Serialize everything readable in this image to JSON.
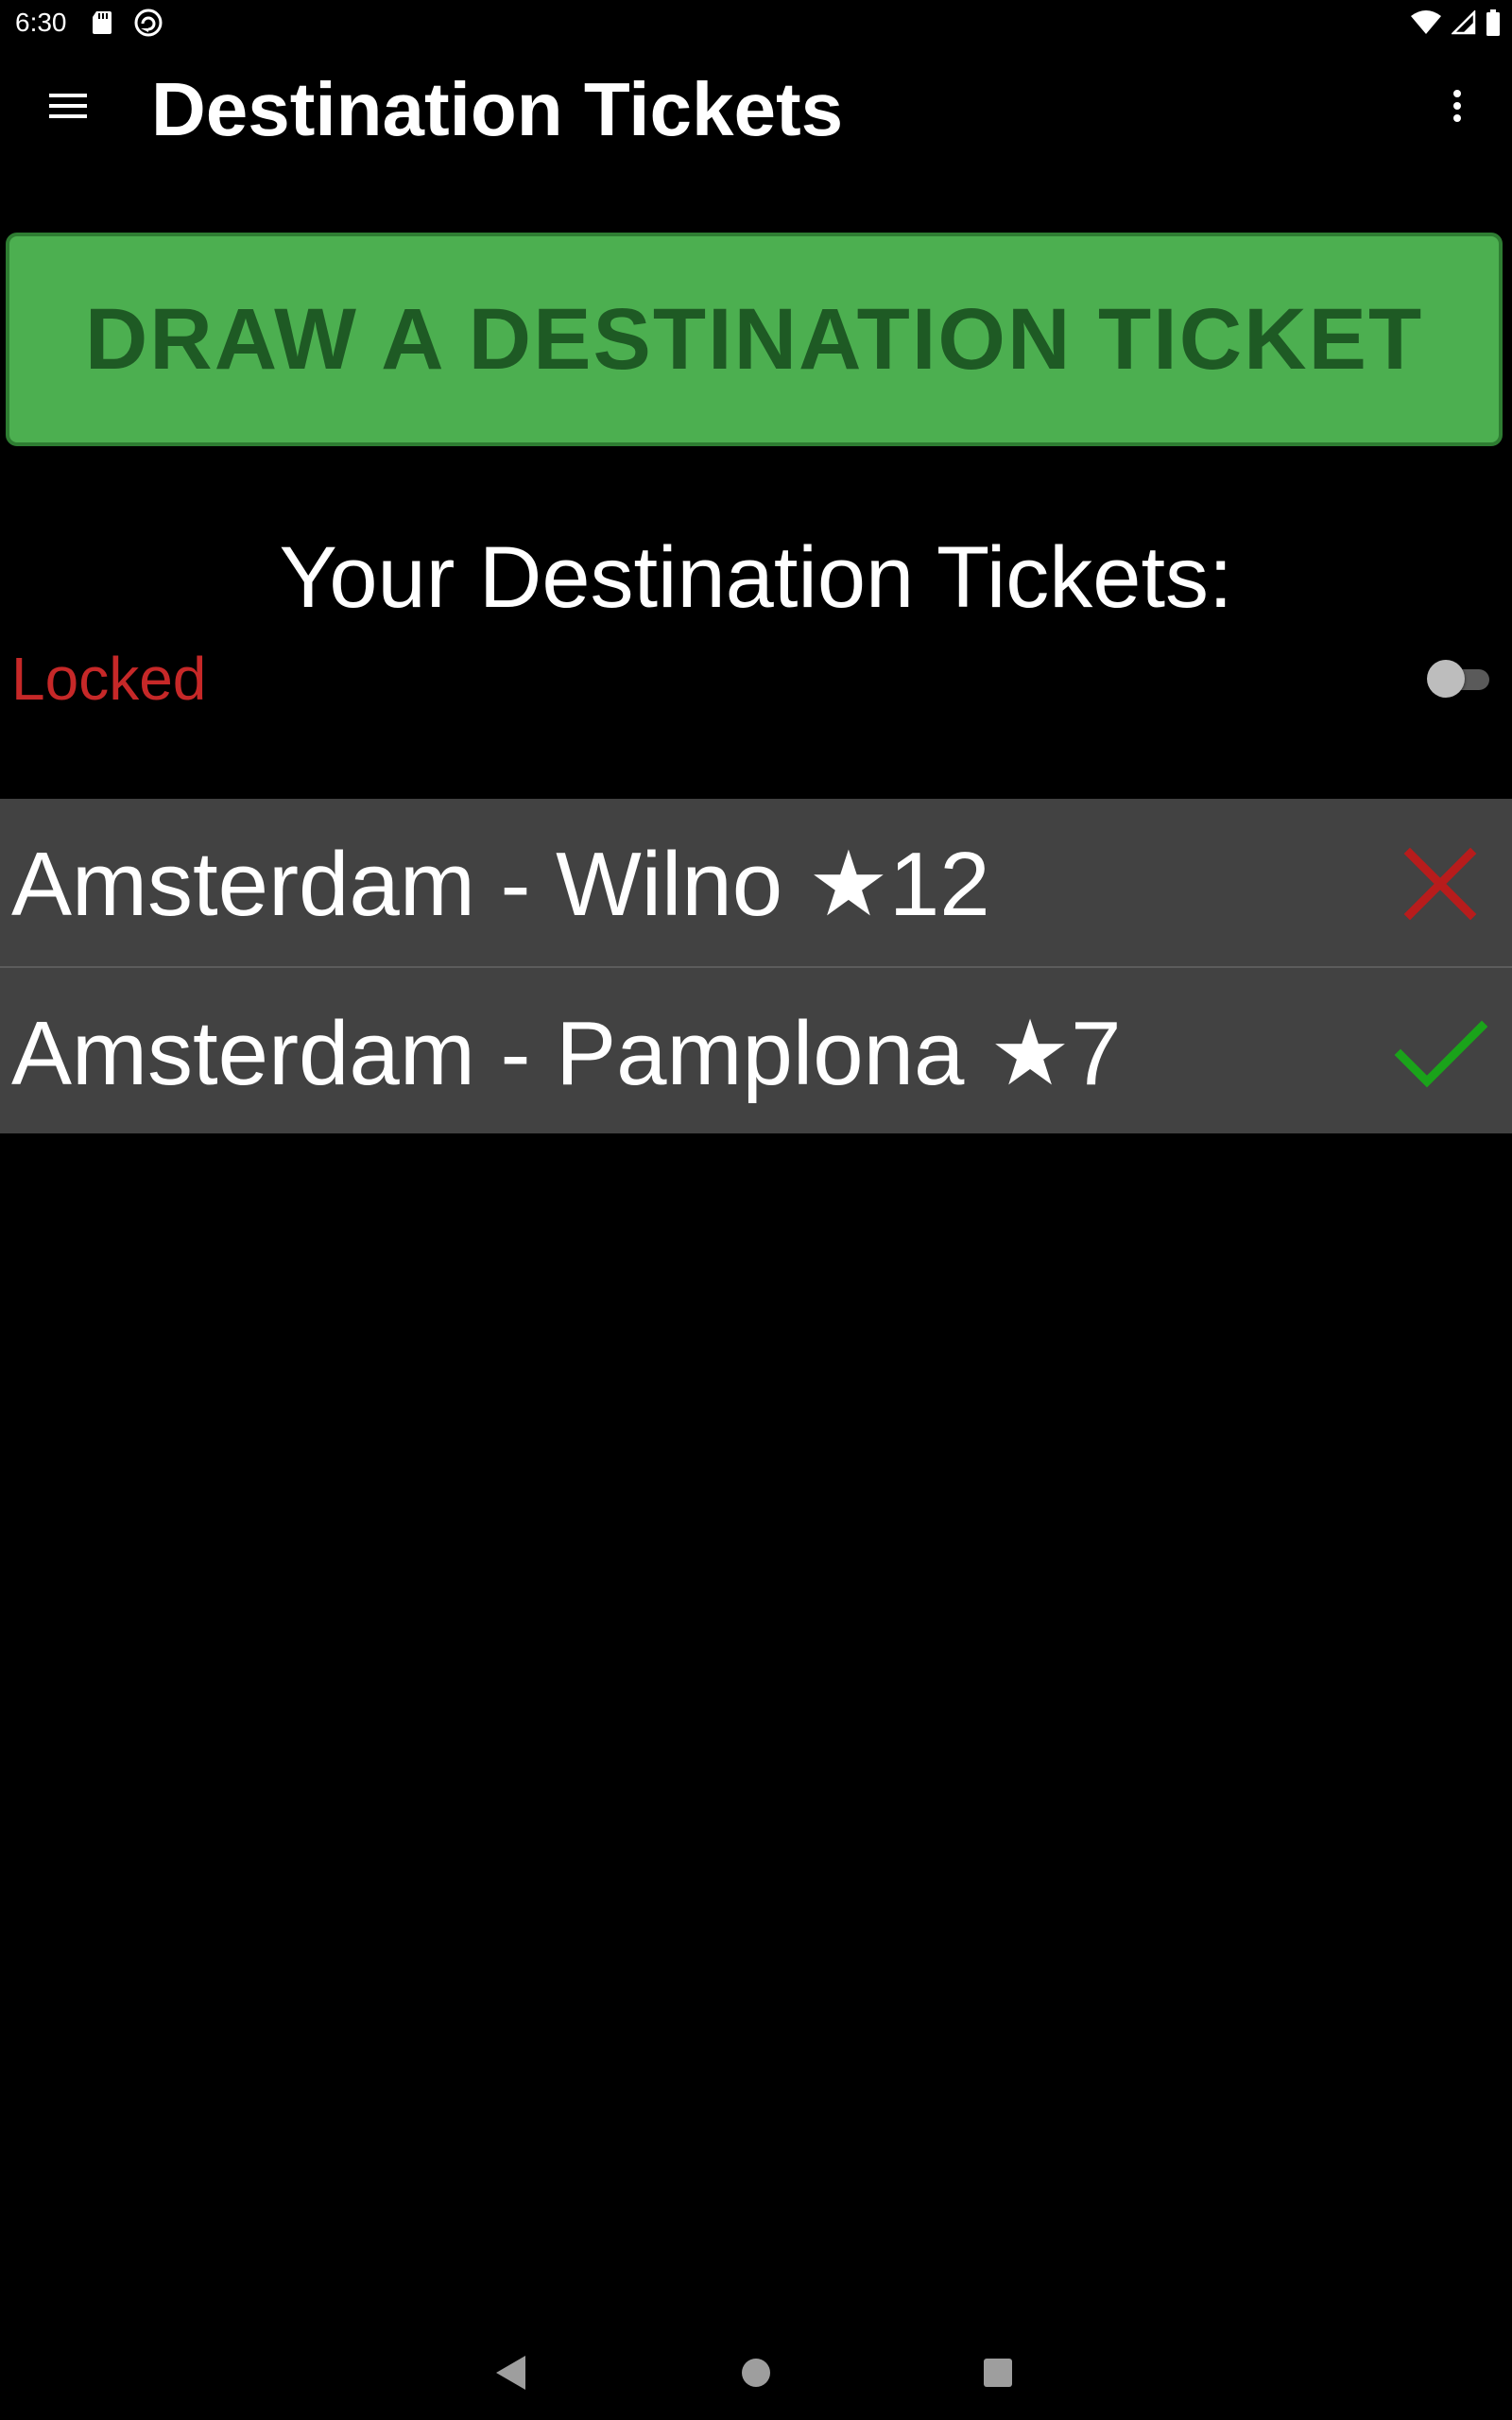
{
  "status_bar": {
    "time": "6:30",
    "icons": [
      "sd-card-icon",
      "sync-icon",
      "wifi-icon",
      "cell-signal-icon",
      "battery-icon"
    ]
  },
  "app_bar": {
    "title": "Destination Tickets",
    "menu_icon": "hamburger-menu-icon",
    "overflow_icon": "more-vert-icon"
  },
  "draw_button": {
    "label": "DRAW A DESTINATION TICKET",
    "background": "#4caf50",
    "text_color": "#1e5a24"
  },
  "section": {
    "heading": "Your Destination Tickets:"
  },
  "lock": {
    "label": "Locked",
    "label_color": "#c62828",
    "switch_on": false
  },
  "tickets": [
    {
      "label": "Amsterdam - Wilno ★12",
      "status": "incomplete",
      "status_icon": "close-icon",
      "status_color": "#b71c1c"
    },
    {
      "label": "Amsterdam - Pamplona ★7",
      "status": "complete",
      "status_icon": "check-icon",
      "status_color": "#1aa31a"
    }
  ],
  "nav_bar": {
    "icons": [
      "back-icon",
      "home-icon",
      "recents-icon"
    ]
  }
}
